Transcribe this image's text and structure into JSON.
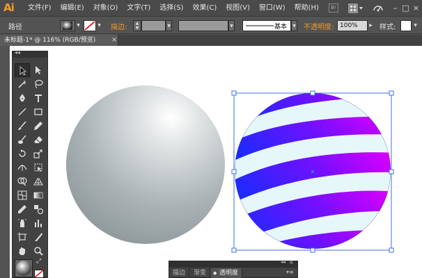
{
  "app": {
    "logo": "Ai"
  },
  "menu": [
    "文件(F)",
    "编辑(E)",
    "对象(O)",
    "文字(T)",
    "选择(S)",
    "效果(C)",
    "视图(V)",
    "窗口(W)",
    "帮助(H)"
  ],
  "header_buttons": {
    "bridge": "Br",
    "minimize": "–",
    "maximize": "□",
    "close": "×"
  },
  "controlbar": {
    "selection_type": "路径",
    "stroke_label": "描边:",
    "stroke_style": "基本",
    "opacity_label": "不透明度:",
    "opacity_value": "100%",
    "style_label": "样式:"
  },
  "document": {
    "tab_title": "未标题-1* @ 116% (RGB/预览)",
    "close": "×"
  },
  "panel": {
    "collapse": "◂◂",
    "close": "×",
    "tabs": [
      "描边",
      "渐变",
      "透明度"
    ],
    "active_tab": 2,
    "menu": "▾≡"
  },
  "colors": {
    "accent": "#f29b2a",
    "selection": "#3d6fe0",
    "stripe_start": "#1b2bff",
    "stripe_end": "#d000ff",
    "sphere_base": "#e6f7fa"
  }
}
